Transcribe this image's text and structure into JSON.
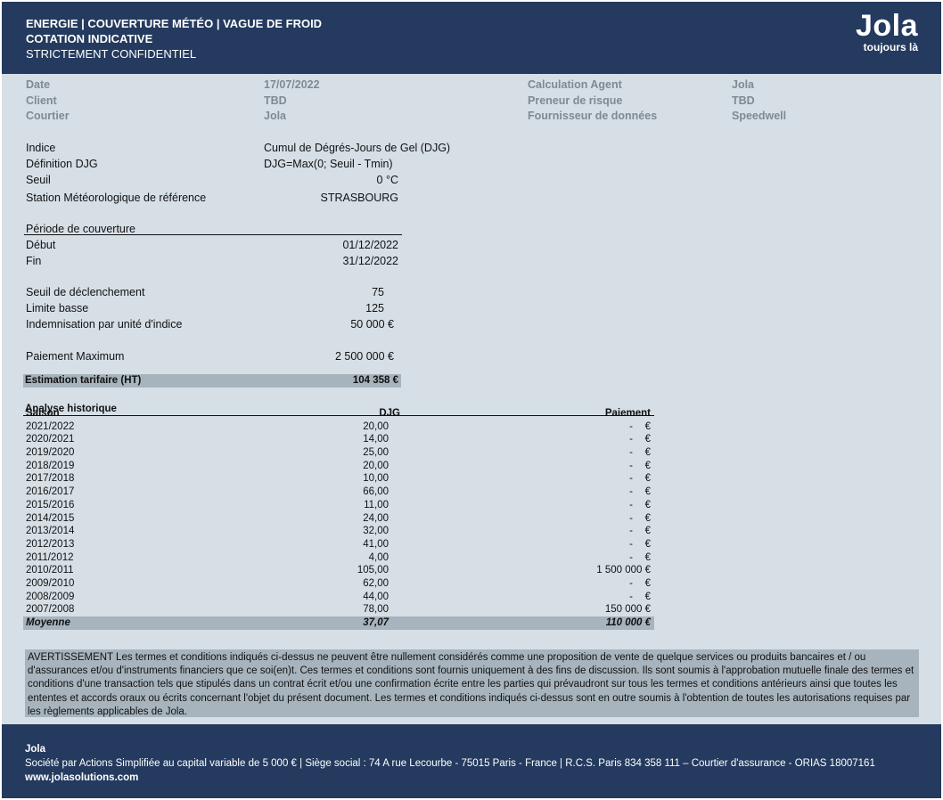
{
  "header": {
    "line1": "ENERGIE |  COUVERTURE MÉTÉO | VAGUE DE FROID",
    "line2": "COTATION INDICATIVE",
    "line3": "STRICTEMENT CONFIDENTIEL",
    "logo_name": "Jola",
    "logo_tagline": "toujours là"
  },
  "meta": {
    "date_label": "Date",
    "date_value": "17/07/2022",
    "client_label": "Client",
    "client_value": "TBD",
    "broker_label": "Courtier",
    "broker_value": "Jola",
    "agent_label": "Calculation Agent",
    "agent_value": "Jola",
    "risk_label": "Preneur de risque",
    "risk_value": "TBD",
    "provider_label": "Fournisseur de données",
    "provider_value": "Speedwell"
  },
  "terms": {
    "index_label": "Indice",
    "index_value": "Cumul de Dégrés-Jours de Gel (DJG)",
    "def_label": "Définition DJG",
    "def_value": "DJG=Max(0; Seuil - Tmin)",
    "threshold_label": "Seuil",
    "threshold_value": "0 °C",
    "station_label": "Station Météorologique de référence",
    "station_value": "STRASBOURG"
  },
  "period": {
    "title": "Période de couverture",
    "start_label": "Début",
    "start_value": "01/12/2022",
    "end_label": "Fin",
    "end_value": "31/12/2022"
  },
  "payout": {
    "trigger_label": "Seuil de déclenchement",
    "trigger_value": "75",
    "low_label": "Limite basse",
    "low_value": "125",
    "indemnity_label": "Indemnisation par unité d'indice",
    "indemnity_value": "50 000 €",
    "max_label": "Paiement Maximum",
    "max_value": "2 500 000 €",
    "estimate_label": "Estimation tarifaire (HT)",
    "estimate_value": "104 358 €"
  },
  "history": {
    "title": "Analyse historique",
    "col_season": "Saison",
    "col_djg": "DJG",
    "col_payment": "Paiement",
    "rows": [
      {
        "season": "2021/2022",
        "djg": "20,00",
        "payment": "-",
        "currency": "€"
      },
      {
        "season": "2020/2021",
        "djg": "14,00",
        "payment": "-",
        "currency": "€"
      },
      {
        "season": "2019/2020",
        "djg": "25,00",
        "payment": "-",
        "currency": "€"
      },
      {
        "season": "2018/2019",
        "djg": "20,00",
        "payment": "-",
        "currency": "€"
      },
      {
        "season": "2017/2018",
        "djg": "10,00",
        "payment": "-",
        "currency": "€"
      },
      {
        "season": "2016/2017",
        "djg": "66,00",
        "payment": "-",
        "currency": "€"
      },
      {
        "season": "2015/2016",
        "djg": "11,00",
        "payment": "-",
        "currency": "€"
      },
      {
        "season": "2014/2015",
        "djg": "24,00",
        "payment": "-",
        "currency": "€"
      },
      {
        "season": "2013/2014",
        "djg": "32,00",
        "payment": "-",
        "currency": "€"
      },
      {
        "season": "2012/2013",
        "djg": "41,00",
        "payment": "-",
        "currency": "€"
      },
      {
        "season": "2011/2012",
        "djg": "4,00",
        "payment": "-",
        "currency": "€"
      },
      {
        "season": "2010/2011",
        "djg": "105,00",
        "payment": "1 500 000 €",
        "currency": ""
      },
      {
        "season": "2009/2010",
        "djg": "62,00",
        "payment": "-",
        "currency": "€"
      },
      {
        "season": "2008/2009",
        "djg": "44,00",
        "payment": "-",
        "currency": "€"
      },
      {
        "season": "2007/2008",
        "djg": "78,00",
        "payment": "150 000 €",
        "currency": ""
      }
    ],
    "avg_label": "Moyenne",
    "avg_djg": "37,07",
    "avg_payment": "110 000 €"
  },
  "disclaimer": "AVERTISSEMENT Les termes et conditions indiqués ci-dessus ne peuvent être nullement considérés comme une proposition de vente de quelque services ou produits bancaires et / ou d'assurances et/ou d'instruments financiers que ce soi(en)t. Ces termes et conditions sont fournis uniquement à des fins de discussion. Ils sont soumis à l'approbation mutuelle finale des termes et conditions d'une transaction tels que stipulés dans un contrat écrit et/ou une confirmation écrite entre les parties qui prévaudront sur tous les termes et conditions antérieurs ainsi que toutes les ententes et accords oraux ou écrits concernant l'objet du présent document. Les termes et conditions indiqués ci-dessus sont en outre soumis à l'obtention de toutes les autorisations requises par les règlements applicables de Jola.",
  "footer": {
    "company": "Jola",
    "legal": "Société par Actions Simplifiée au capital variable de 5 000 € | Siège social : 74 A rue Lecourbe - 75015 Paris - France | R.C.S. Paris 834 358 111 – Courtier d'assurance - ORIAS 18007161",
    "website": "www.jolasolutions.com"
  }
}
